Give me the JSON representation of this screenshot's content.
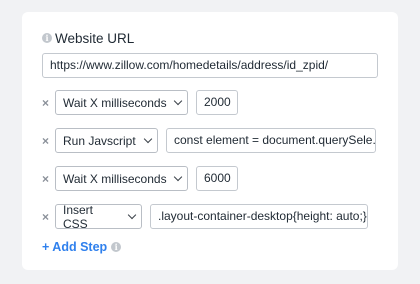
{
  "website_url": {
    "label": "Website URL",
    "value": "https://www.zillow.com/homedetails/address/id_zpid/"
  },
  "icons": {
    "info": "info-icon",
    "remove": "close-icon",
    "dropdown": "chevron-down-icon"
  },
  "remove_glyph": "×",
  "info_glyph": "i",
  "steps": [
    {
      "action": "Wait X milliseconds",
      "value": "2000"
    },
    {
      "action": "Run Javscript",
      "value": "const element = document.querySele.."
    },
    {
      "action": "Wait X milliseconds",
      "value": "6000"
    },
    {
      "action": "Insert CSS",
      "value": ".layout-container-desktop{height: auto;}"
    }
  ],
  "add_step_label": "+ Add Step",
  "colors": {
    "link": "#2f80ed",
    "background": "#f1f2f4",
    "card": "#ffffff"
  }
}
